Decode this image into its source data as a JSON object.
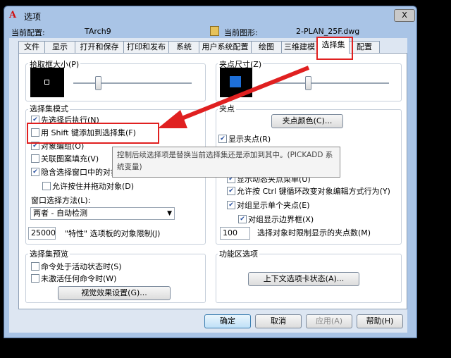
{
  "window": {
    "title": "选项",
    "close_label": "X"
  },
  "header": {
    "profile_label": "当前配置:",
    "profile_value": "TArch9",
    "drawing_label": "当前图形:",
    "drawing_value": "2-PLAN_25F.dwg"
  },
  "tabs": [
    {
      "label": "文件"
    },
    {
      "label": "显示"
    },
    {
      "label": "打开和保存"
    },
    {
      "label": "打印和发布"
    },
    {
      "label": "系统"
    },
    {
      "label": "用户系统配置"
    },
    {
      "label": "绘图"
    },
    {
      "label": "三维建模"
    },
    {
      "label": "选择集",
      "active": true
    },
    {
      "label": "配置"
    }
  ],
  "left": {
    "pickbox": {
      "title": "拾取框大小(P)"
    },
    "modes": {
      "title": "选择集模式",
      "items": [
        {
          "label": "先选择后执行(N)",
          "checked": true
        },
        {
          "label": "用 Shift 键添加到选择集(F)",
          "checked": false
        },
        {
          "label": "对象编组(O)",
          "checked": true
        },
        {
          "label": "关联图案填充(V)",
          "checked": false
        },
        {
          "label": "隐含选择窗口中的对象",
          "checked": true
        },
        {
          "label": "允许按住并拖动对象(D)",
          "checked": false
        }
      ],
      "window_method_label": "窗口选择方法(L):",
      "window_method_value": "两者 - 自动检测",
      "limit_value": "25000",
      "limit_label": "\"特性\" 选项板的对象限制(J)"
    },
    "preview": {
      "title": "选择集预览",
      "items": [
        {
          "label": "命令处于活动状态时(S)",
          "checked": false
        },
        {
          "label": "未激活任何命令时(W)",
          "checked": false
        }
      ],
      "visual_button": "视觉效果设置(G)..."
    }
  },
  "right": {
    "gripsize": {
      "title": "夹点尺寸(Z)"
    },
    "grips": {
      "title": "夹点",
      "color_button": "夹点颜色(C)...",
      "items": [
        {
          "label": "显示夹点(R)",
          "checked": true
        },
        {
          "label": "显示动态夹点菜单(U)",
          "checked": true
        },
        {
          "label": "允许按 Ctrl 键循环改变对象编辑方式行为(Y)",
          "checked": true
        },
        {
          "label": "对组显示单个夹点(E)",
          "checked": true
        },
        {
          "label": "对组显示边界框(X)",
          "checked": true
        }
      ],
      "limit_value": "100",
      "limit_label": "选择对象时限制显示的夹点数(M)"
    },
    "ribbon": {
      "title": "功能区选项",
      "context_button": "上下文选项卡状态(A)..."
    }
  },
  "tooltip": {
    "text": "控制后续选择项是替换当前选择集还是添加到其中。(PICKADD 系统变量)"
  },
  "buttons": {
    "ok": "确定",
    "cancel": "取消",
    "apply": "应用(A)",
    "help": "帮助(H)"
  },
  "colors": {
    "highlight": "#e02020",
    "grip": "#1e6fd8"
  }
}
